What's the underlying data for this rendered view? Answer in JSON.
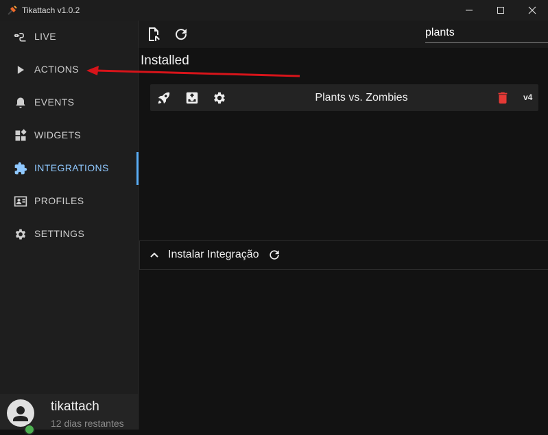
{
  "window": {
    "title": "Tikattach v1.0.2"
  },
  "sidebar": {
    "items": [
      {
        "label": "LIVE",
        "icon": "plug-icon"
      },
      {
        "label": "ACTIONS",
        "icon": "play-icon"
      },
      {
        "label": "EVENTS",
        "icon": "bell-icon"
      },
      {
        "label": "WIDGETS",
        "icon": "widgets-icon"
      },
      {
        "label": "INTEGRATIONS",
        "icon": "puzzle-icon",
        "active": true
      },
      {
        "label": "PROFILES",
        "icon": "profile-card-icon"
      },
      {
        "label": "SETTINGS",
        "icon": "gear-icon"
      }
    ]
  },
  "user": {
    "name": "tikattach",
    "subtitle": "12 dias restantes"
  },
  "search": {
    "value": "plants"
  },
  "main": {
    "installed_title": "Installed",
    "integrations": [
      {
        "name": "Plants vs. Zombies",
        "version": "v4"
      }
    ],
    "install_section": {
      "label": "Instalar Integração"
    }
  },
  "colors": {
    "accent": "#8fc8ff",
    "active_bar": "#5aaef7",
    "delete": "#e53935",
    "annotation_arrow": "#d7141a",
    "status_online": "#4caf50"
  }
}
